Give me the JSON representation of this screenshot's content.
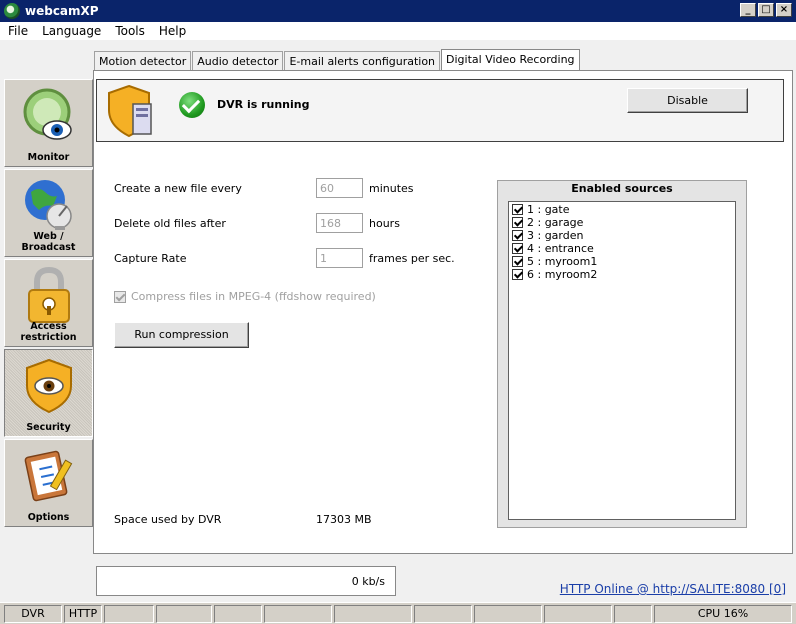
{
  "window": {
    "title": "webcamXP",
    "controls": [
      "_",
      "□",
      "×"
    ]
  },
  "menu": [
    "File",
    "Language",
    "Tools",
    "Help"
  ],
  "sidebar": {
    "items": [
      {
        "label": "Monitor",
        "icon": "monitor-eye-icon"
      },
      {
        "label": "Web / Broadcast",
        "icon": "globe-satellite-icon"
      },
      {
        "label": "Access restriction",
        "icon": "padlock-icon"
      },
      {
        "label": "Security",
        "icon": "shield-eye-icon"
      },
      {
        "label": "Options",
        "icon": "clipboard-pencil-icon"
      }
    ],
    "active": "Security"
  },
  "tabs": [
    "Motion detector",
    "Audio detector",
    "E-mail alerts configuration",
    "Digital Video Recording"
  ],
  "active_tab": "Digital Video Recording",
  "status": {
    "text": "DVR is running",
    "button": "Disable"
  },
  "settings": {
    "new_file": {
      "label": "Create a new file every",
      "value": "60",
      "unit": "minutes"
    },
    "delete_old": {
      "label": "Delete old files after",
      "value": "168",
      "unit": "hours"
    },
    "capture_rate": {
      "label": "Capture Rate",
      "value": "1",
      "unit": "frames per sec."
    },
    "compress": {
      "label": "Compress files in MPEG-4 (ffdshow required)",
      "checked": true,
      "disabled": true
    },
    "run_button": "Run compression"
  },
  "space": {
    "label": "Space used by DVR",
    "value": "17303 MB"
  },
  "sources": {
    "title": "Enabled sources",
    "items": [
      "1 : gate",
      "2 : garage",
      "3 : garden",
      "4 : entrance",
      "5 : myroom1",
      "6 : myroom2"
    ]
  },
  "footer": {
    "rate": "0 kb/s",
    "http_status": "HTTP Online @ http://SALITE:8080 [0]"
  },
  "statusbar": {
    "dvr": "DVR",
    "http": "HTTP",
    "cpu": "CPU 16%"
  }
}
